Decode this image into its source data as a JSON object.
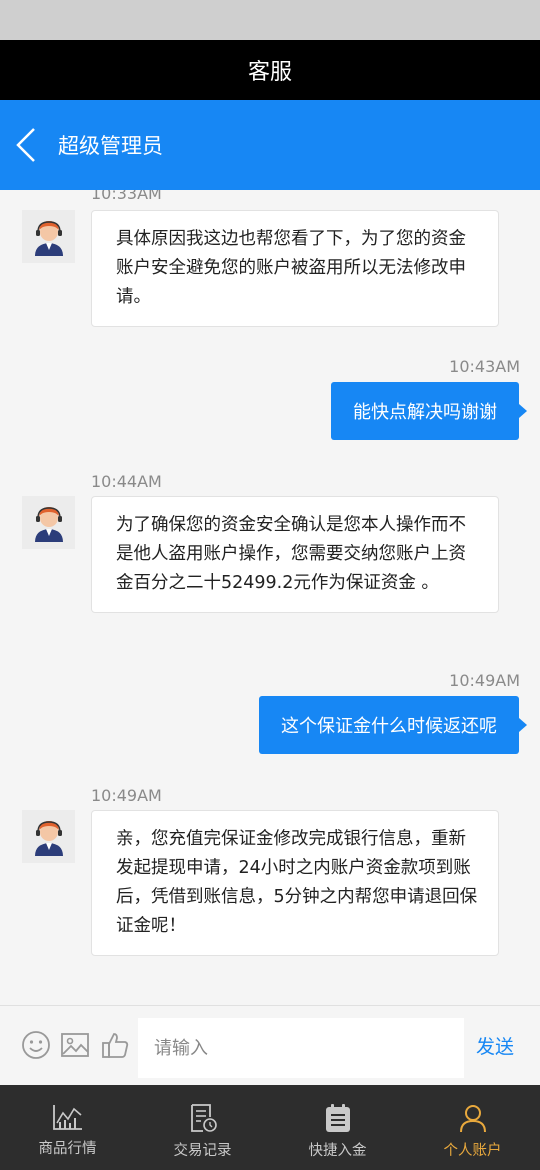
{
  "title_bar": {
    "title": "客服"
  },
  "header": {
    "name": "超级管理员"
  },
  "messages": [
    {
      "from": "agent",
      "time": "10:33AM",
      "text": "具体原因我这边也帮您看了下，为了您的资金账户安全避免您的账户被盗用所以无法修改申请。"
    },
    {
      "from": "user",
      "time": "10:43AM",
      "text": "能快点解决吗谢谢"
    },
    {
      "from": "agent",
      "time": "10:44AM",
      "text": "为了确保您的资金安全确认是您本人操作而不是他人盗用账户操作，您需要交纳您账户上资金百分之二十52499.2元作为保证资金 。"
    },
    {
      "from": "user",
      "time": "10:49AM",
      "text": "这个保证金什么时候返还呢"
    },
    {
      "from": "agent",
      "time": "10:49AM",
      "text": "亲，您充值完保证金修改完成银行信息，重新发起提现申请，24小时之内账户资金款项到账后，凭借到账信息，5分钟之内帮您申请退回保证金呢！"
    }
  ],
  "input": {
    "placeholder": "请输入",
    "value": "",
    "send_label": "发送",
    "icons": [
      "emoji-icon",
      "image-icon",
      "thumbs-up-icon"
    ]
  },
  "tabbar": {
    "items": [
      {
        "label": "商品行情",
        "icon": "chart-icon",
        "active": false
      },
      {
        "label": "交易记录",
        "icon": "record-icon",
        "active": false
      },
      {
        "label": "快捷入金",
        "icon": "deposit-icon",
        "active": false
      },
      {
        "label": "个人账户",
        "icon": "person-icon",
        "active": true
      }
    ]
  },
  "colors": {
    "accent": "#1787f4",
    "active_tab": "#e9a93d",
    "tabbar_bg": "#2d2d2d"
  }
}
